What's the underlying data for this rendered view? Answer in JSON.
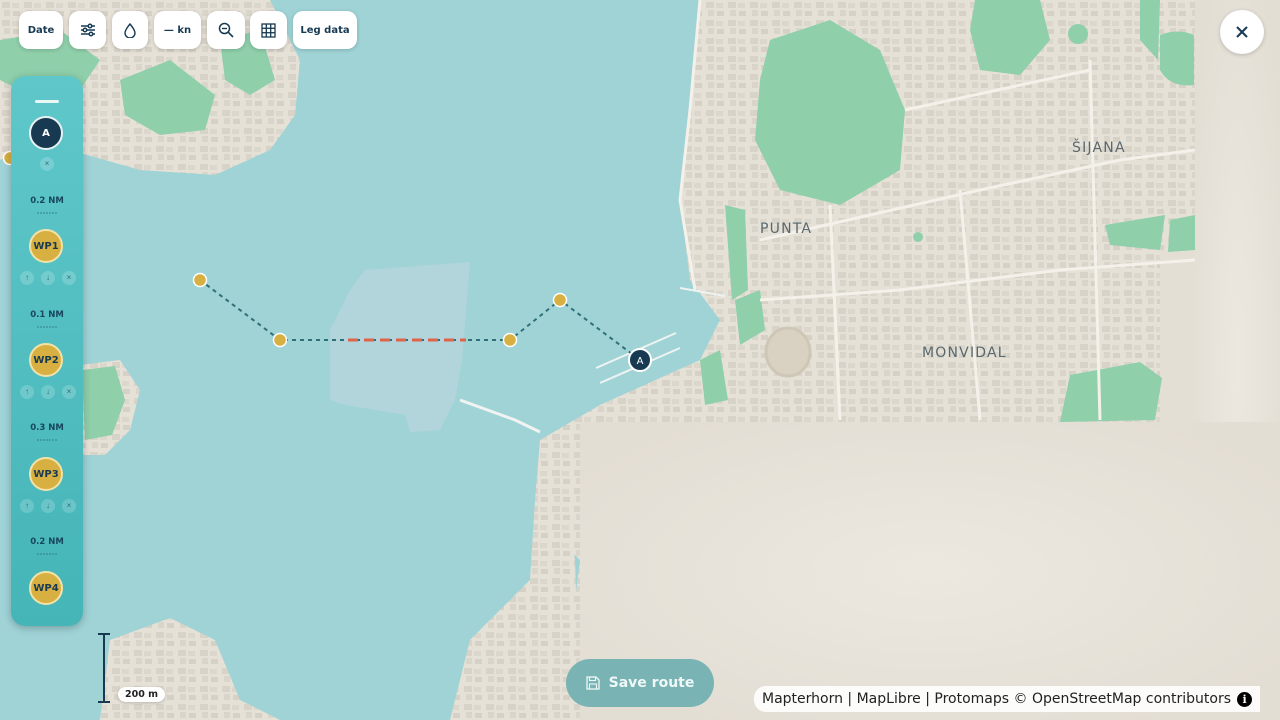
{
  "toolbar": {
    "date_label": "Date",
    "speed_label": "— kn",
    "leg_data_label": "Leg data",
    "icons": [
      "sliders-icon",
      "drop-icon",
      "zoom-out-icon",
      "grid-icon"
    ]
  },
  "route_panel": {
    "waypoints": [
      {
        "label": "A",
        "type": "start"
      },
      {
        "label": "WP1",
        "type": "waypoint"
      },
      {
        "label": "WP2",
        "type": "waypoint"
      },
      {
        "label": "WP3",
        "type": "waypoint"
      },
      {
        "label": "WP4",
        "type": "waypoint"
      }
    ],
    "legs": [
      {
        "distance": "0.2 NM"
      },
      {
        "distance": "0.1 NM"
      },
      {
        "distance": "0.3 NM"
      },
      {
        "distance": "0.2 NM"
      }
    ],
    "control_glyphs": {
      "up": "↑",
      "down": "↓",
      "remove": "×"
    }
  },
  "map": {
    "places": [
      {
        "name": "ŠIJANA"
      },
      {
        "name": "PUNTA"
      },
      {
        "name": "MONVIDAL"
      }
    ],
    "start_marker_label": "A",
    "colors": {
      "water": "#9fd3d6",
      "land": "#e8e3d9",
      "park": "#8fcfaa",
      "route": "#2f6f77",
      "route_highlight": "#e0634a",
      "waypoint": "#d8b042",
      "start": "#173a52"
    }
  },
  "scale": {
    "label": "200 m"
  },
  "save_button": {
    "label": "Save route"
  },
  "attribution": {
    "text": "Mapterhorn | MapLibre | Protomaps © OpenStreetMap contributors"
  }
}
